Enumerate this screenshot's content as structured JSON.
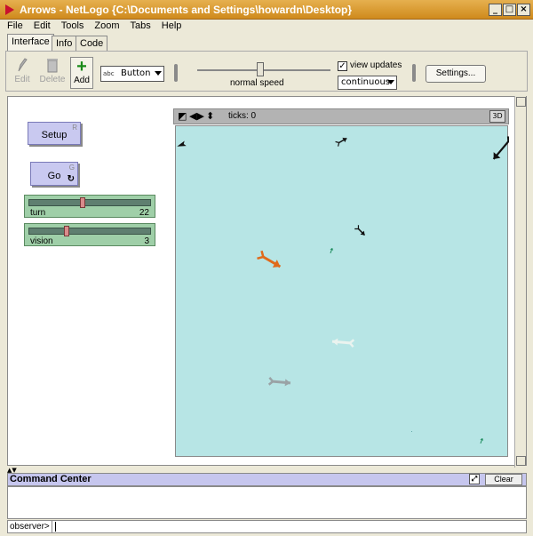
{
  "window": {
    "title": "Arrows - NetLogo {C:\\Documents and Settings\\howardn\\Desktop}"
  },
  "window_buttons": {
    "minimize": "_",
    "maximize": "□",
    "close": "×"
  },
  "menu": [
    "File",
    "Edit",
    "Tools",
    "Zoom",
    "Tabs",
    "Help"
  ],
  "tabs": [
    "Interface",
    "Info",
    "Code"
  ],
  "toolbar": {
    "edit_label": "Edit",
    "delete_label": "Delete",
    "add_label": "Add",
    "widget_select": "Button",
    "widget_select_icon": "abc",
    "speed_label": "normal speed",
    "speed_value": 0.5,
    "view_updates_label": "view updates",
    "view_updates_checked": true,
    "update_mode": "continuous",
    "settings_label": "Settings..."
  },
  "widgets": {
    "setup": {
      "label": "Setup",
      "key": "R"
    },
    "go": {
      "label": "Go",
      "key": "G",
      "forever": true
    },
    "turn": {
      "label": "turn",
      "value": "22",
      "fraction": 0.44
    },
    "vision": {
      "label": "vision",
      "value": "3",
      "fraction": 0.3
    }
  },
  "view": {
    "ticks_label": "ticks: 0",
    "btn_3d": "3D"
  },
  "command_center": {
    "title": "Command Center",
    "clear_label": "Clear",
    "observer_prompt": "observer>"
  },
  "colors": {
    "titlebar": "#d99530",
    "button": "#c9c9f0",
    "slider": "#9fcfa8",
    "world": "#b7e5e5",
    "orange_arrow": "#e06a1a"
  }
}
